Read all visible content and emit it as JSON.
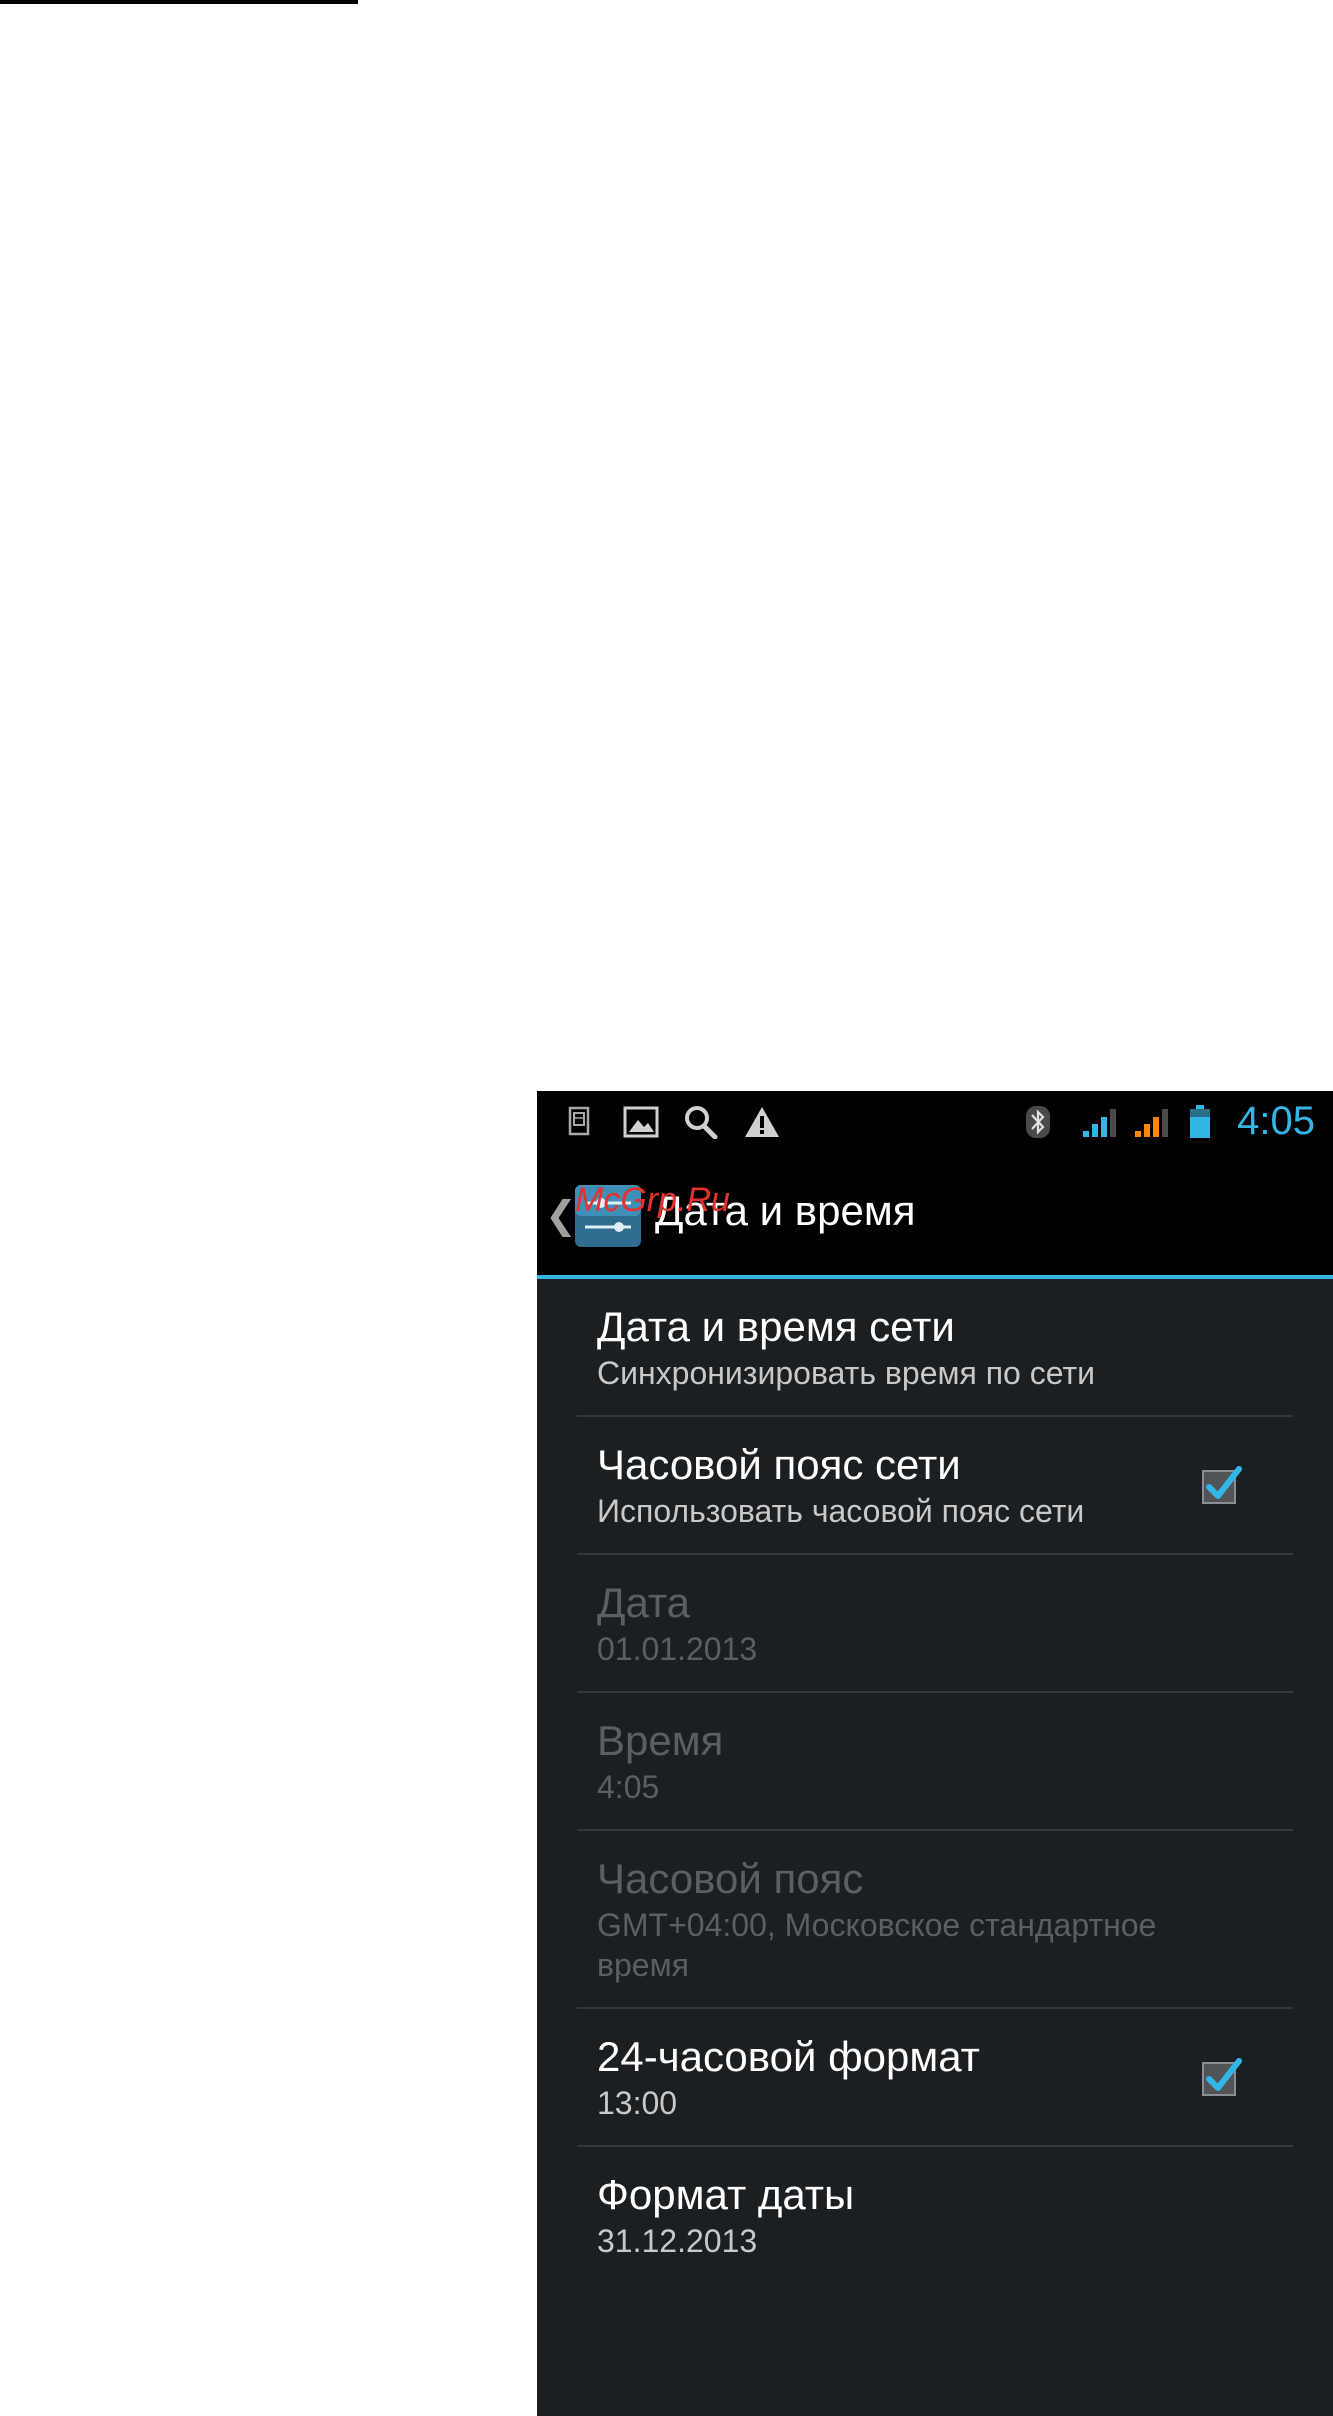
{
  "status_bar": {
    "time": "4:05",
    "left_icons": [
      "sim-toolkit-icon",
      "gallery-icon",
      "search-icon",
      "warning-icon"
    ],
    "right_icons": [
      "bluetooth-icon",
      "signal-blue-icon",
      "signal-orange-icon",
      "battery-icon"
    ],
    "accent_color": "#33b5e5"
  },
  "action_bar": {
    "title": "Дата и время",
    "watermark": "McGrp.Ru"
  },
  "settings": [
    {
      "title": "Дата и время сети",
      "summary": "Синхронизировать время по сети",
      "enabled": true,
      "checkbox": false
    },
    {
      "title": "Часовой пояс сети",
      "summary": "Использовать часовой пояс сети",
      "enabled": true,
      "checkbox": true,
      "checked": true
    },
    {
      "title": "Дата",
      "summary": "01.01.2013",
      "enabled": false,
      "checkbox": false
    },
    {
      "title": "Время",
      "summary": "4:05",
      "enabled": false,
      "checkbox": false
    },
    {
      "title": "Часовой пояс",
      "summary": "GMT+04:00, Московское стандартное время",
      "enabled": false,
      "checkbox": false
    },
    {
      "title": "24-часовой формат",
      "summary": "13:00",
      "enabled": true,
      "checkbox": true,
      "checked": true
    },
    {
      "title": "Формат даты",
      "summary": "31.12.2013",
      "enabled": true,
      "checkbox": false
    }
  ]
}
